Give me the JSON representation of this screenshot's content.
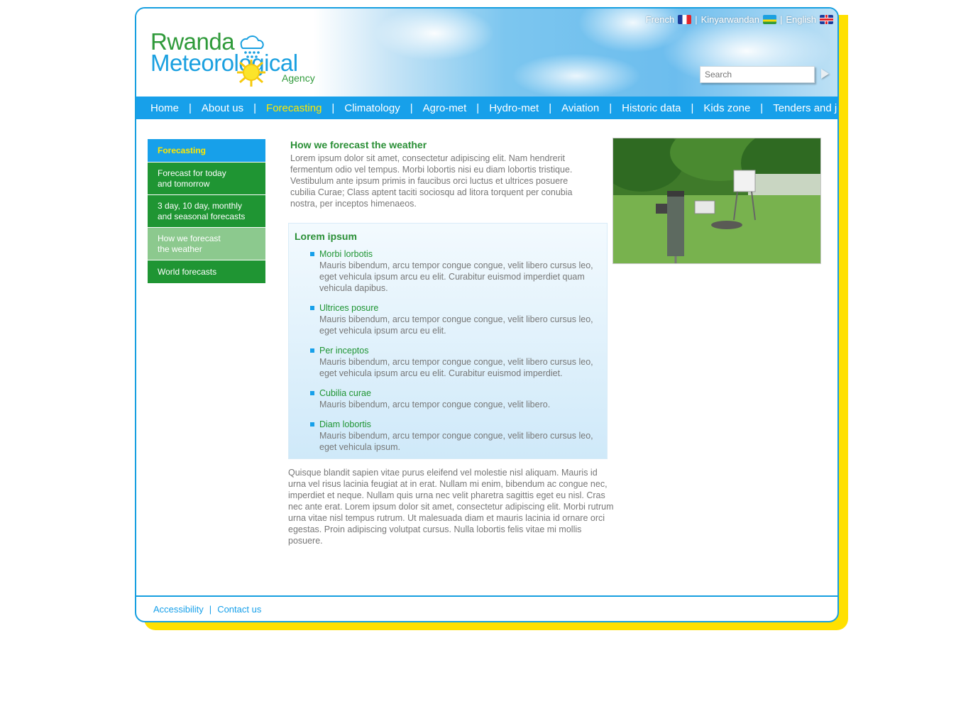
{
  "header": {
    "logo": {
      "line1": "Rwanda",
      "line2": "Meteorological",
      "line3": "Agency"
    },
    "languages": [
      {
        "label": "French",
        "flag": "france-flag-icon"
      },
      {
        "label": "Kinyarwandan",
        "flag": "rwanda-flag-icon"
      },
      {
        "label": "English",
        "flag": "uk-flag-icon"
      }
    ],
    "language_separator": "|",
    "search": {
      "placeholder": "Search",
      "go_icon": "play-arrow-icon"
    }
  },
  "nav": {
    "separator": "|",
    "items": [
      {
        "label": "Home"
      },
      {
        "label": "About us"
      },
      {
        "label": "Forecasting",
        "active": true
      },
      {
        "label": "Climatology"
      },
      {
        "label": "Agro-met"
      },
      {
        "label": "Hydro-met"
      },
      {
        "label": "Aviation"
      },
      {
        "label": "Historic data"
      },
      {
        "label": "Kids zone"
      },
      {
        "label": "Tenders and jobs"
      }
    ]
  },
  "sidebar": {
    "heading": "Forecasting",
    "items": [
      {
        "line1": "Forecast for today",
        "line2": "and tomorrow"
      },
      {
        "line1": "3 day, 10 day, monthly",
        "line2": "and seasonal forecasts"
      },
      {
        "line1": "How we forecast",
        "line2": "the weather",
        "selected": true
      },
      {
        "line1": "World forecasts",
        "line2": ""
      }
    ]
  },
  "main": {
    "title": "How we forecast the weather",
    "intro": "Lorem ipsum dolor sit amet, consectetur adipiscing elit. Nam hendrerit fermentum odio vel tempus. Morbi lobortis nisi eu diam lobortis tristique. Vestibulum ante ipsum primis in faucibus orci luctus et ultrices posuere cubilia Curae; Class aptent taciti sociosqu ad litora torquent per conubia nostra, per inceptos himenaeos.",
    "box": {
      "title": "Lorem ipsum",
      "items": [
        {
          "title": "Morbi lorbotis",
          "text": "Mauris bibendum, arcu tempor congue congue, velit libero cursus leo, eget vehicula ipsum arcu eu elit. Curabitur euismod imperdiet quam vehicula dapibus."
        },
        {
          "title": "Ultrices posure",
          "text": "Mauris bibendum, arcu tempor congue congue, velit libero cursus leo, eget vehicula ipsum arcu eu elit."
        },
        {
          "title": "Per inceptos",
          "text": "Mauris bibendum, arcu tempor congue congue, velit libero cursus leo, eget vehicula ipsum arcu eu elit. Curabitur euismod imperdiet."
        },
        {
          "title": "Cubilia curae",
          "text": "Mauris bibendum, arcu tempor congue congue, velit libero."
        },
        {
          "title": "Diam lobortis",
          "text": "Mauris bibendum, arcu tempor congue congue, velit libero cursus leo, eget vehicula ipsum."
        }
      ]
    },
    "outro": "Quisque blandit sapien vitae purus eleifend vel molestie nisl aliquam. Mauris id urna vel risus lacinia feugiat at in erat. Nullam mi enim, bibendum ac congue nec, imperdiet et neque. Nullam quis urna nec velit pharetra sagittis eget eu nisl. Cras nec ante erat. Lorem ipsum dolor sit amet, consectetur adipiscing elit. Morbi rutrum urna vitae nisl tempus rutrum. Ut malesuada diam et mauris lacinia id ornare orci egestas. Proin adipiscing volutpat cursus. Nulla lobortis felis vitae mi mollis posuere."
  },
  "footer": {
    "links": [
      {
        "label": "Accessibility"
      },
      {
        "label": "Contact us"
      }
    ],
    "separator": "|"
  },
  "colors": {
    "brand_blue": "#17a0ea",
    "brand_green": "#1f9533",
    "accent_yellow": "#ffe800",
    "text_gray": "#777777"
  }
}
